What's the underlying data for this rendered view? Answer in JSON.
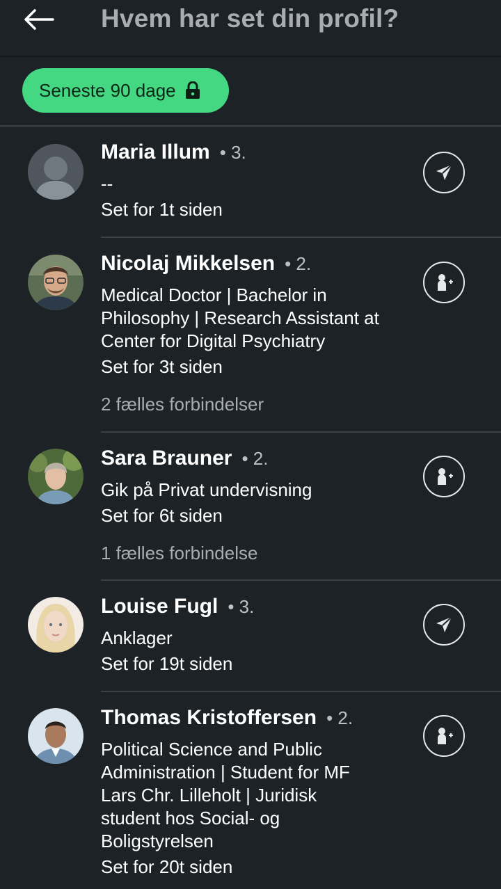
{
  "header": {
    "title": "Hvem har set din profil?"
  },
  "filter": {
    "label": "Seneste 90 dage",
    "icon": "lock-icon",
    "color": "#45d883"
  },
  "viewers": [
    {
      "name": "Maria Illum",
      "degree": "• 3.",
      "headline": "--",
      "seen": "Set for 1t siden",
      "mutual": "",
      "action": "send-message-icon"
    },
    {
      "name": "Nicolaj Mikkelsen",
      "degree": "• 2.",
      "headline": "Medical Doctor | Bachelor in Philosophy | Research Assistant at Center for Digital Psychiatry",
      "seen": "Set for 3t siden",
      "mutual": "2 fælles forbindelser",
      "action": "add-connection-icon"
    },
    {
      "name": "Sara Brauner",
      "degree": "• 2.",
      "headline": "Gik på Privat undervisning",
      "seen": "Set for 6t siden",
      "mutual": "1 fælles forbindelse",
      "action": "add-connection-icon"
    },
    {
      "name": "Louise Fugl",
      "degree": "• 3.",
      "headline": "Anklager",
      "seen": "Set for 19t siden",
      "mutual": "",
      "action": "send-message-icon"
    },
    {
      "name": "Thomas Kristoffersen",
      "degree": "• 2.",
      "headline": "Political Science and Public Administration | Student for MF Lars Chr. Lilleholt | Juridisk student hos Social- og Boligstyrelsen",
      "seen": "Set for 20t siden",
      "mutual": "",
      "action": "add-connection-icon"
    }
  ]
}
